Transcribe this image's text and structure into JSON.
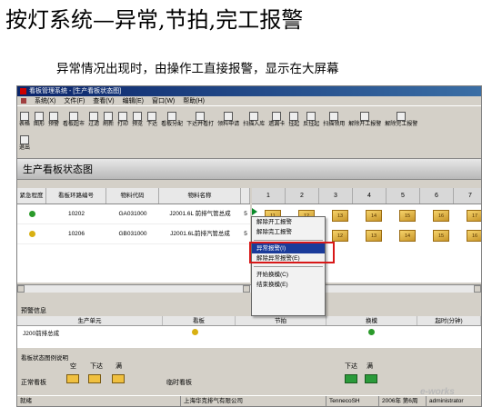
{
  "slide": {
    "title": "按灯系统—异常,节拍,完工报警",
    "subtitle": "异常情况出现时，由操作工直接报警，显示在大屏幕"
  },
  "window": {
    "title": "看板管理系统 - [生产看板状态图]"
  },
  "menu": [
    "系统(X)",
    "文件(F)",
    "查看(V)",
    "编辑(E)",
    "窗口(W)",
    "帮助(H)"
  ],
  "toolbar": {
    "row1": [
      "表格",
      "图形",
      "预警",
      "看板超市",
      "过滤",
      "刷新",
      "打印",
      "预览",
      "下达",
      "看板分配",
      "下达并看打",
      "领料申请",
      "扫描入库",
      "遗漏卡",
      "挂起",
      "反挂起",
      "扫描领用",
      "解除开工报警",
      "解除完工报警"
    ],
    "row2": [
      "退出"
    ]
  },
  "view_title": "生产看板状态图",
  "grid": {
    "headers": [
      "紧急程度",
      "看板环路编号",
      "物料代码",
      "物料名称"
    ],
    "rows": [
      {
        "code": "10202",
        "material": "GA031000",
        "name": "J2001.6L 前排气管总成",
        "qty": "5",
        "status": "green"
      },
      {
        "code": "10206",
        "material": "GB031000",
        "name": "J2001.6L前排汽管总成",
        "qty": "5",
        "status": "yellow"
      }
    ]
  },
  "calendar": {
    "headers": [
      "1",
      "2",
      "3",
      "4",
      "5",
      "6",
      "7",
      "8"
    ],
    "row1": [
      "11",
      "12",
      "13",
      "14",
      "15",
      "16",
      "17",
      "28"
    ],
    "row2": [
      "10",
      "11",
      "12",
      "13",
      "14",
      "15",
      "16",
      "17"
    ]
  },
  "alarm": {
    "title": "预警信息",
    "headers": [
      "生产单元",
      "看板",
      "节拍",
      "换模",
      "起时(分钟)"
    ],
    "row": {
      "unit": "J200前排总成"
    }
  },
  "legend": {
    "title": "看板状态图例说明",
    "labels": [
      "空",
      "下达",
      "满",
      "下达",
      "满"
    ],
    "rows": [
      "正常看板",
      "临时看板"
    ]
  },
  "context_menu": {
    "items": [
      "解除开工报警",
      "解除完工报警",
      "异常报警(I)",
      "解除异常报警(E)",
      "开始换模(C)",
      "结束换模(E)"
    ],
    "selected_index": 2
  },
  "statusbar": {
    "ready": "就绪",
    "company": "上海华克排气有限公司",
    "user": "TennecoSH",
    "week": "2006年 第6周",
    "admin": "administrator"
  },
  "watermark": "e-works",
  "colors": {
    "titlebar": "#0a246a",
    "selected": "#1a3b9a",
    "highlight": "#d81818"
  }
}
